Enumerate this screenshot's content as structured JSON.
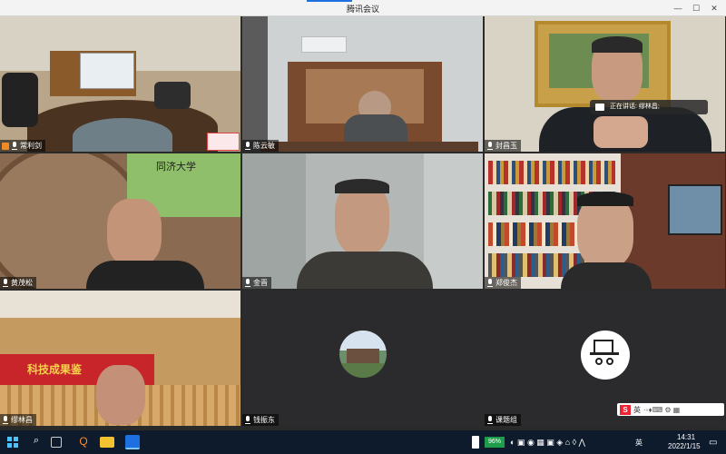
{
  "window": {
    "title": "腾讯会议",
    "accent_color": "#1e6fe0"
  },
  "participants": [
    {
      "name": "常利剑"
    },
    {
      "name": "陈云敏"
    },
    {
      "name": "封昌玉"
    },
    {
      "name": "黄茂松"
    },
    {
      "name": "金晋"
    },
    {
      "name": "郑俊杰"
    },
    {
      "name": "缪林昌"
    },
    {
      "name": "钱振东"
    },
    {
      "name": "课题组"
    }
  ],
  "speaking_indicator": {
    "text": "正在讲话: 缪林昌;"
  },
  "banner_text": "科技成果鉴",
  "university_logo_text": "同济大学",
  "ime_bar": {
    "label": "英"
  },
  "taskbar": {
    "battery": "96%",
    "lang": "英",
    "time": "14:31",
    "date": "2022/1/15"
  }
}
